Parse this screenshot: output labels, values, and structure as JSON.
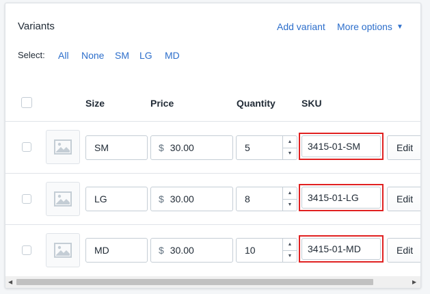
{
  "header": {
    "title": "Variants",
    "add_variant": "Add variant",
    "more_options": "More options",
    "more_options_caret": "▼"
  },
  "select": {
    "label": "Select:",
    "options": [
      "All",
      "None",
      "SM",
      "LG",
      "MD"
    ]
  },
  "columns": {
    "size": "Size",
    "price": "Price",
    "quantity": "Quantity",
    "sku": "SKU"
  },
  "currency_symbol": "$",
  "variants": [
    {
      "size": "SM",
      "price": "30.00",
      "quantity": "5",
      "sku": "3415-01-SM",
      "edit": "Edit"
    },
    {
      "size": "LG",
      "price": "30.00",
      "quantity": "8",
      "sku": "3415-01-LG",
      "edit": "Edit"
    },
    {
      "size": "MD",
      "price": "30.00",
      "quantity": "10",
      "sku": "3415-01-MD",
      "edit": "Edit"
    }
  ],
  "colors": {
    "link": "#2c6ecb",
    "highlight": "#e02020",
    "border": "#c4cdd5"
  },
  "icons": [
    "image-placeholder-icon",
    "caret-down-icon",
    "spinner-up-icon",
    "spinner-down-icon",
    "scroll-left-icon",
    "scroll-right-icon"
  ]
}
